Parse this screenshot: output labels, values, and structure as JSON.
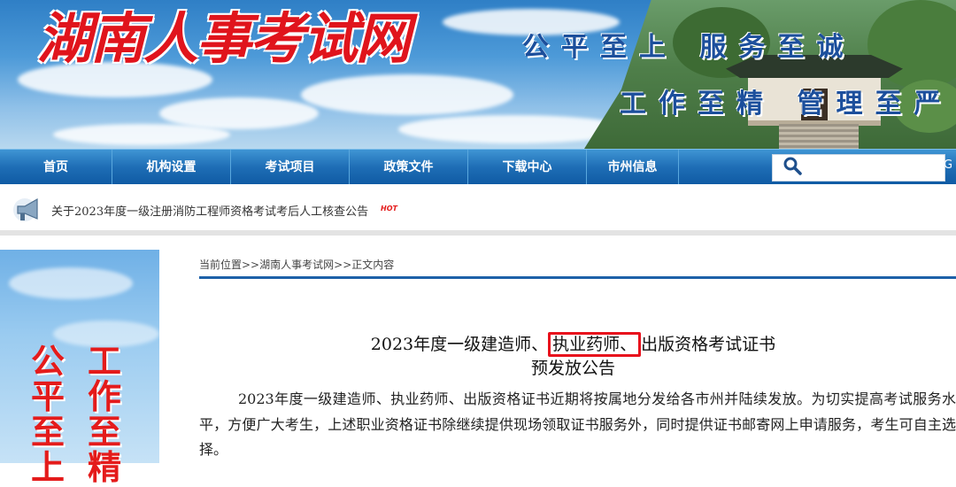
{
  "header": {
    "site_title": "湖南人事考试网",
    "slogan_1": "公平至上 服务至诚",
    "slogan_2": "工作至精 管理至严"
  },
  "nav": {
    "items": [
      "首页",
      "机构设置",
      "考试项目",
      "政策文件",
      "下载中心",
      "市州信息"
    ],
    "search_placeholder": "",
    "go_label": "G"
  },
  "notice": {
    "text": "关于2023年度一级注册消防工程师资格考试考后人工核查公告",
    "badge": "HOT"
  },
  "side_banner": {
    "col_left": [
      "公",
      "平",
      "至",
      "上"
    ],
    "col_right": [
      "工",
      "作",
      "至",
      "精"
    ]
  },
  "breadcrumb": {
    "prefix": "当前位置>>",
    "link_1": "湖南人事考试网",
    "sep": ">>",
    "link_2": "正文内容"
  },
  "article": {
    "title_part_1": "2023年度一级建造师、",
    "title_highlight": "执业药师、",
    "title_part_2": "出版资格考试证书",
    "title_line_2": "预发放公告",
    "body": "2023年度一级建造师、执业药师、出版资格证书近期将按属地分发给各市州并陆续发放。为切实提高考试服务水平，方便广大考生，上述职业资格证书除继续提供现场领取证书服务外，同时提供证书邮寄网上申请服务，考生可自主选择。"
  },
  "colors": {
    "nav_bg": "#1e6db5",
    "title_red": "#e0141c",
    "highlight_box": "#e8101c",
    "slogan_blue": "#1c4f9c"
  }
}
